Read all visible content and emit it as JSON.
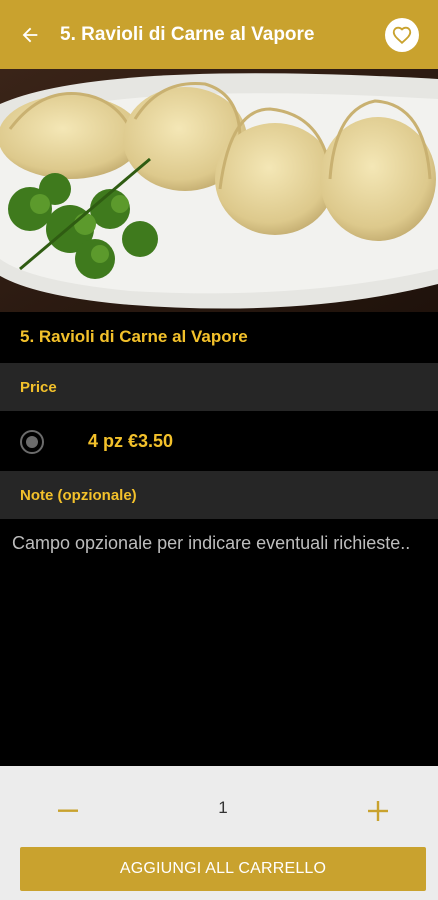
{
  "header": {
    "title": "5. Ravioli di Carne al Vapore",
    "back_icon": "arrow-left-icon",
    "favorite_icon": "heart-outline-icon",
    "bg_color": "#c9a22e"
  },
  "product": {
    "image": "dumplings-photo",
    "title": "5. Ravioli di Carne al Vapore"
  },
  "price_section": {
    "header": "Price",
    "options": [
      {
        "label": "4 pz  €3.50",
        "selected": true
      }
    ]
  },
  "note_section": {
    "header": "Note (opzionale)",
    "placeholder": "Campo opzionale per indicare eventuali richieste.."
  },
  "cart": {
    "quantity": "1",
    "minus_icon": "minus-icon",
    "plus_icon": "plus-icon",
    "add_label": "AGGIUNGI ALL CARRELLO"
  },
  "colors": {
    "accent": "#c9a22e",
    "title_yellow": "#f3c12b",
    "section_bg": "#262626"
  }
}
